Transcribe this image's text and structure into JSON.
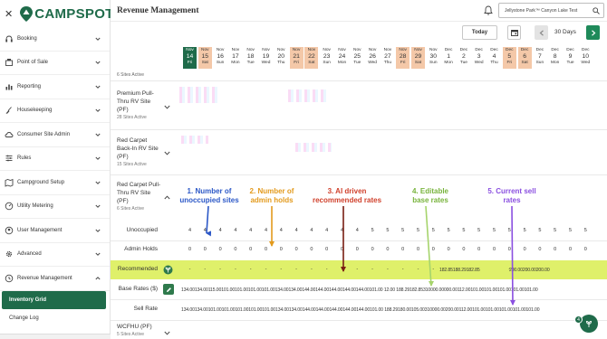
{
  "app": {
    "brand": "CAMPSPOT",
    "close_icon": "close-icon"
  },
  "sidebar": {
    "items": [
      {
        "label": "Booking",
        "icon": "headset-icon"
      },
      {
        "label": "Point of Sale",
        "icon": "register-icon"
      },
      {
        "label": "Reporting",
        "icon": "bar-chart-icon"
      },
      {
        "label": "Housekeeping",
        "icon": "broom-icon"
      },
      {
        "label": "Consumer Site Admin",
        "icon": "cloud-icon"
      },
      {
        "label": "Rules",
        "icon": "rules-icon"
      },
      {
        "label": "Campground Setup",
        "icon": "map-icon"
      },
      {
        "label": "Utility Metering",
        "icon": "meter-icon"
      },
      {
        "label": "User Management",
        "icon": "user-icon"
      },
      {
        "label": "Advanced",
        "icon": "gear-icon"
      },
      {
        "label": "Revenue Management",
        "icon": "revenue-icon"
      }
    ],
    "sub_items": [
      {
        "label": "Inventory Grid",
        "active": true
      },
      {
        "label": "Change Log",
        "active": false
      }
    ]
  },
  "header": {
    "title": "Revenue Management",
    "park": "Jellystone Park™ Canyon Lake Test"
  },
  "toolbar": {
    "today_label": "Today",
    "days_label": "30 Days"
  },
  "dates": [
    {
      "mon": "Nov",
      "day": "14",
      "dow": "Fri",
      "type": "today"
    },
    {
      "mon": "Nov",
      "day": "15",
      "dow": "Sat",
      "type": "wknd"
    },
    {
      "mon": "Nov",
      "day": "16",
      "dow": "Sun",
      "type": ""
    },
    {
      "mon": "Nov",
      "day": "17",
      "dow": "Mon",
      "type": ""
    },
    {
      "mon": "Nov",
      "day": "18",
      "dow": "Tue",
      "type": ""
    },
    {
      "mon": "Nov",
      "day": "19",
      "dow": "Wed",
      "type": ""
    },
    {
      "mon": "Nov",
      "day": "20",
      "dow": "Thu",
      "type": ""
    },
    {
      "mon": "Nov",
      "day": "21",
      "dow": "Fri",
      "type": "wknd"
    },
    {
      "mon": "Nov",
      "day": "22",
      "dow": "Sat",
      "type": "wknd"
    },
    {
      "mon": "Nov",
      "day": "23",
      "dow": "Sun",
      "type": ""
    },
    {
      "mon": "Nov",
      "day": "24",
      "dow": "Mon",
      "type": ""
    },
    {
      "mon": "Nov",
      "day": "25",
      "dow": "Tue",
      "type": ""
    },
    {
      "mon": "Nov",
      "day": "26",
      "dow": "Wed",
      "type": ""
    },
    {
      "mon": "Nov",
      "day": "27",
      "dow": "Thu",
      "type": ""
    },
    {
      "mon": "Nov",
      "day": "28",
      "dow": "Fri",
      "type": "wknd"
    },
    {
      "mon": "Nov",
      "day": "29",
      "dow": "Sat",
      "type": "wknd"
    },
    {
      "mon": "Nov",
      "day": "30",
      "dow": "Sun",
      "type": ""
    },
    {
      "mon": "Dec",
      "day": "1",
      "dow": "Mon",
      "type": ""
    },
    {
      "mon": "Dec",
      "day": "2",
      "dow": "Tue",
      "type": ""
    },
    {
      "mon": "Dec",
      "day": "3",
      "dow": "Wed",
      "type": ""
    },
    {
      "mon": "Dec",
      "day": "4",
      "dow": "Thu",
      "type": ""
    },
    {
      "mon": "Dec",
      "day": "5",
      "dow": "Fri",
      "type": "wknd"
    },
    {
      "mon": "Dec",
      "day": "6",
      "dow": "Sat",
      "type": "wknd"
    },
    {
      "mon": "Dec",
      "day": "7",
      "dow": "Sun",
      "type": ""
    },
    {
      "mon": "Dec",
      "day": "8",
      "dow": "Mon",
      "type": ""
    },
    {
      "mon": "Dec",
      "day": "9",
      "dow": "Tue",
      "type": ""
    },
    {
      "mon": "Dec",
      "day": "10",
      "dow": "Wed",
      "type": ""
    }
  ],
  "grid": {
    "top_sites_active": "6 Sites Active",
    "groups": [
      {
        "name": "Premium Pull-Thru RV Site (PF)",
        "sub": "28 Sites Active"
      },
      {
        "name": "Red Carpet Back-In RV Site (PF)",
        "sub": "15 Sites Active"
      },
      {
        "name": "Red Carpet Pull-Thru RV Site (PF)",
        "sub": "6 Sites Active"
      },
      {
        "name": "WCFHU (PF)",
        "sub": "5 Sites Active"
      }
    ],
    "rows": {
      "unoccupied_label": "Unoccupied",
      "admin_holds_label": "Admin Holds",
      "recommended_label": "Recommended",
      "base_rates_label": "Base Rates ($)",
      "sell_rate_label": "Sell Rate"
    },
    "unoccupied": [
      "4",
      "4",
      "4",
      "4",
      "4",
      "4",
      "4",
      "4",
      "4",
      "4",
      "4",
      "4",
      "5",
      "5",
      "5",
      "5",
      "5",
      "5",
      "5",
      "5",
      "5",
      "5",
      "5",
      "5",
      "5",
      "5",
      "5"
    ],
    "admin_holds": [
      "0",
      "0",
      "0",
      "0",
      "0",
      "0",
      "0",
      "0",
      "0",
      "0",
      "0",
      "0",
      "0",
      "0",
      "0",
      "0",
      "0",
      "0",
      "0",
      "0",
      "0",
      "0",
      "0",
      "0",
      "0",
      "0",
      "0"
    ],
    "recommended_dashes": [
      "-",
      "-",
      "-",
      "-",
      "-",
      "-",
      "-",
      "-",
      "-",
      "-",
      "-",
      "-",
      "-",
      "-",
      "-",
      "-",
      "-",
      "-",
      "-",
      "-",
      "-",
      "-",
      "-",
      "-",
      "-",
      "-",
      "-"
    ],
    "recommended_mid": "182.85188.29182.85",
    "recommended_tail": "200.00200.00200.00",
    "base_rates": "134.00134.00115.00101.00101.00101.00101.00134.00134.00144.00144.00144.00144.00144.00101.00 12.00 188.29182.85310000.00000.00112.00101.00101.00101.00101.00101.00",
    "sell_rate": "134.00134.00101.00101.00101.00101.00101.00134.00134.00144.00144.00144.00144.00144.00101.00 188.29180.00105.00310000.00200.00112.00101.00101.00101.00101.00101.00"
  },
  "annotations": [
    {
      "text": "1. Number of unoccupied sites",
      "color": "#2c58c7"
    },
    {
      "text": "2. Number of admin holds",
      "color": "#e39a1c"
    },
    {
      "text": "3. AI driven recommended rates",
      "color": "#d0412c"
    },
    {
      "text": "4. Editable base rates",
      "color": "#78b33c"
    },
    {
      "text": "5. Current sell rates",
      "color": "#8a4fe0"
    }
  ],
  "fab": {
    "badge": "4"
  }
}
